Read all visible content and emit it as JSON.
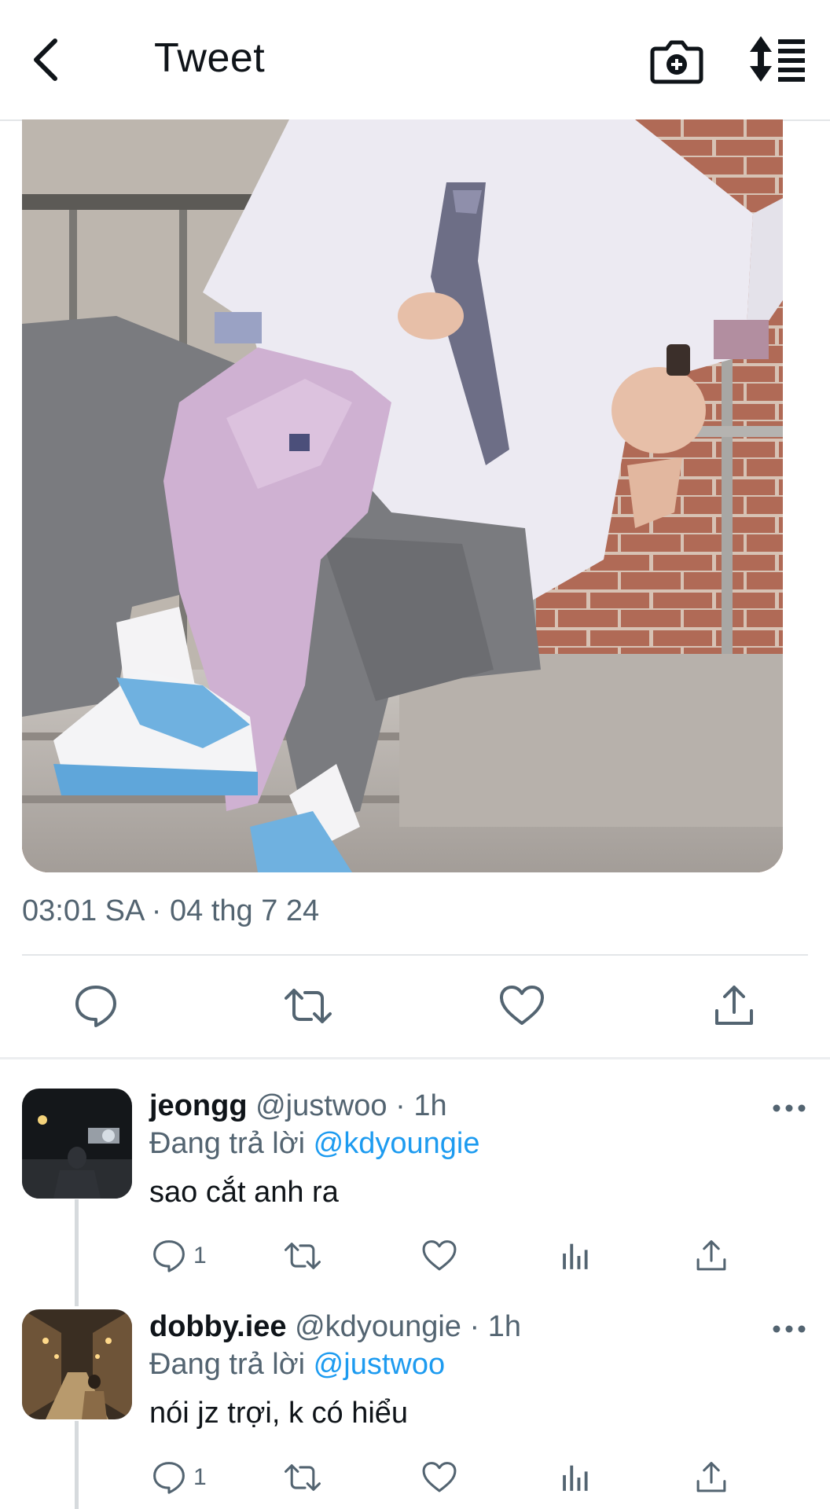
{
  "header": {
    "title": "Tweet",
    "icons": [
      "back-arrow-icon",
      "camera-plus-icon",
      "sort-icon"
    ]
  },
  "tweet": {
    "timestamp": "03:01 SA · 04 thg 7 24",
    "actions": [
      "reply-icon",
      "retweet-icon",
      "like-icon",
      "share-icon"
    ]
  },
  "replies": [
    {
      "name": "jeongg",
      "handle": "@justwoo",
      "separator": "·",
      "time": "1h",
      "replying_prefix": "Đang trả lời",
      "replying_to": "@kdyoungie",
      "text": "sao cắt anh ra",
      "reply_count": "1"
    },
    {
      "name": "dobby.iee",
      "handle": "@kdyoungie",
      "separator": "·",
      "time": "1h",
      "replying_prefix": "Đang trả lời",
      "replying_to": "@justwoo",
      "text": "nói jz trợi, k có hiểu",
      "reply_count": "1"
    }
  ],
  "colors": {
    "accent": "#1d9bf0",
    "muted_text": "#536471",
    "text": "#0f1419",
    "divider": "#e3e6e8"
  }
}
